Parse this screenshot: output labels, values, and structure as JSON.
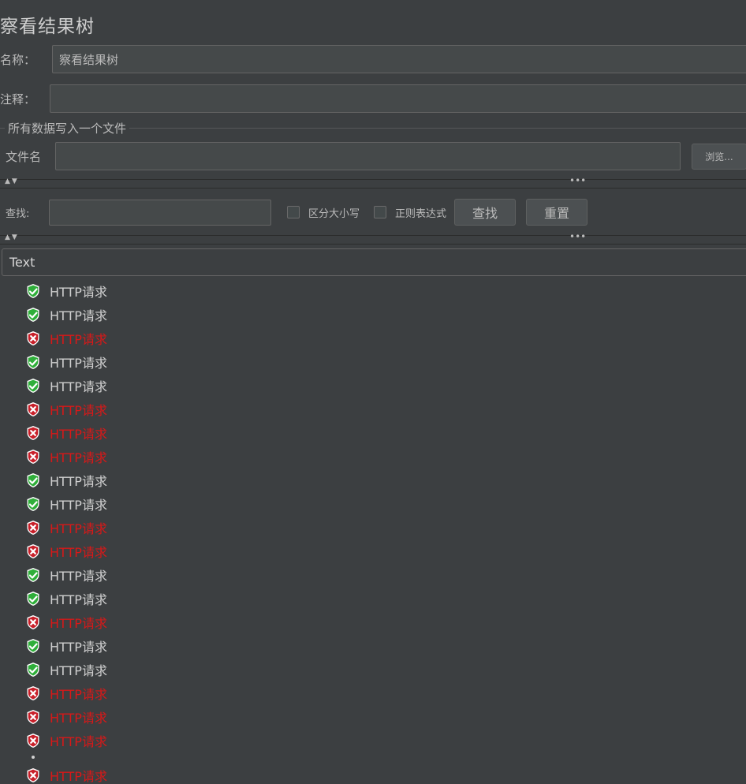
{
  "panel": {
    "title": "察看结果树",
    "name_label": "名称：",
    "name_value": "察看结果树",
    "comment_label": "注释：",
    "comment_value": ""
  },
  "file_group": {
    "title": "所有数据写入一个文件",
    "filename_label": "文件名",
    "filename_value": "",
    "browse_label": "浏览..."
  },
  "splitter": {
    "arrows": "▲▼",
    "dots": "•••"
  },
  "search": {
    "label": "查找:",
    "value": "",
    "case_sensitive_label": "区分大小写",
    "case_sensitive_checked": false,
    "regex_label": "正则表达式",
    "regex_checked": false,
    "find_button": "查找",
    "reset_button": "重置"
  },
  "renderer": {
    "selected": "Text"
  },
  "tree": {
    "items": [
      {
        "label": "HTTP请求",
        "status": "success"
      },
      {
        "label": "HTTP请求",
        "status": "success"
      },
      {
        "label": "HTTP请求",
        "status": "error"
      },
      {
        "label": "HTTP请求",
        "status": "success"
      },
      {
        "label": "HTTP请求",
        "status": "success"
      },
      {
        "label": "HTTP请求",
        "status": "error"
      },
      {
        "label": "HTTP请求",
        "status": "error"
      },
      {
        "label": "HTTP请求",
        "status": "error"
      },
      {
        "label": "HTTP请求",
        "status": "success"
      },
      {
        "label": "HTTP请求",
        "status": "success"
      },
      {
        "label": "HTTP请求",
        "status": "error"
      },
      {
        "label": "HTTP请求",
        "status": "error"
      },
      {
        "label": "HTTP请求",
        "status": "success"
      },
      {
        "label": "HTTP请求",
        "status": "success"
      },
      {
        "label": "HTTP请求",
        "status": "error"
      },
      {
        "label": "HTTP请求",
        "status": "success"
      },
      {
        "label": "HTTP请求",
        "status": "success"
      },
      {
        "label": "HTTP请求",
        "status": "error"
      },
      {
        "label": "HTTP请求",
        "status": "error"
      },
      {
        "label": "HTTP请求",
        "status": "error"
      },
      {
        "label": "HTTP请求",
        "status": "error"
      }
    ]
  },
  "colors": {
    "background": "#3c3f41",
    "success_icon": "#2fae3a",
    "error_icon": "#c8202a",
    "error_text": "#d91818"
  },
  "icons": {
    "success": "shield-check-icon",
    "error": "shield-x-icon"
  }
}
